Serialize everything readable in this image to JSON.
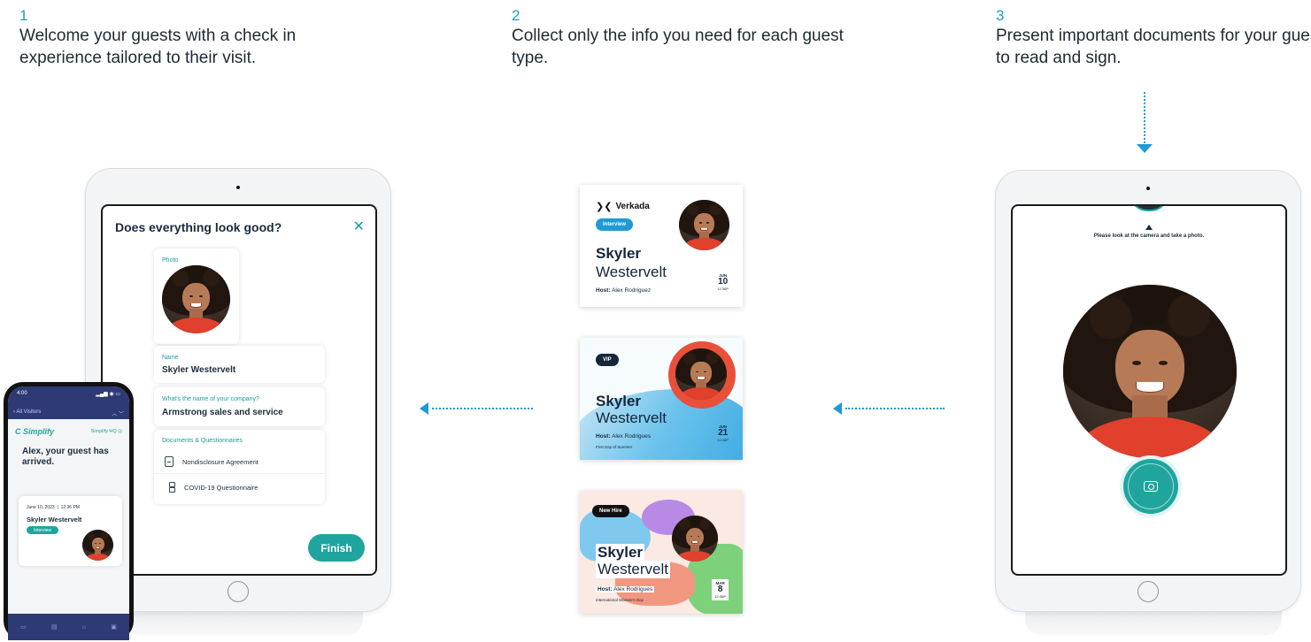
{
  "steps": [
    {
      "number": "1",
      "text": "Welcome your guests with a check in experience tailored to their visit."
    },
    {
      "number": "2",
      "text": "Collect only the info you need for each guest type."
    },
    {
      "number": "3",
      "text": "Present important documents for your guests to read and sign."
    }
  ],
  "tablet1": {
    "title": "Does everything look good?",
    "close_icon": "close-icon",
    "photo_label": "Photo",
    "name_label": "Name",
    "name_value": "Skyler Westervelt",
    "company_label": "What's the name of your company?",
    "company_value": "Armstrong sales and service",
    "docs_label": "Documents & Questionnaires",
    "doc1": "Nondisclosure Agreement",
    "doc2": "COVID-19 Questionnaire",
    "finish_label": "Finish"
  },
  "phone": {
    "time": "4:00",
    "back_label": "All Visitors",
    "brand": "Simplify",
    "location": "Simplify HQ",
    "message": "Alex, your guest has arrived.",
    "date": "June 10, 2023",
    "time_visit": "12:36 PM",
    "guest_name": "Skyler Westervelt",
    "tag": "Interview"
  },
  "badges": [
    {
      "logo": "Verkada",
      "pill": "Interview",
      "first": "Skyler",
      "last": "Westervelt",
      "host_label": "Host:",
      "host": "Alex Rodriguez",
      "sub": "",
      "month": "JUN",
      "day": "10",
      "time": "12:36P"
    },
    {
      "logo": "",
      "pill": "VIP",
      "first": "Skyler",
      "last": "Westervelt",
      "host_label": "Host:",
      "host": "Alex Rodrigues",
      "sub": "First Day of Summer",
      "month": "JUN",
      "day": "21",
      "time": "12:36P"
    },
    {
      "logo": "",
      "pill": "New Hire",
      "first": "Skyler",
      "last": "Westervelt",
      "host_label": "Host:",
      "host": "Alex Rodrigues",
      "sub": "International Women's Day",
      "month": "MAR",
      "day": "8",
      "time": "12:36P"
    }
  ],
  "tablet3": {
    "caption": "Please look at the camera and take a photo."
  },
  "colors": {
    "accent": "#1fa59e",
    "arrow": "#1f9ad6",
    "text": "#1d2a34"
  }
}
